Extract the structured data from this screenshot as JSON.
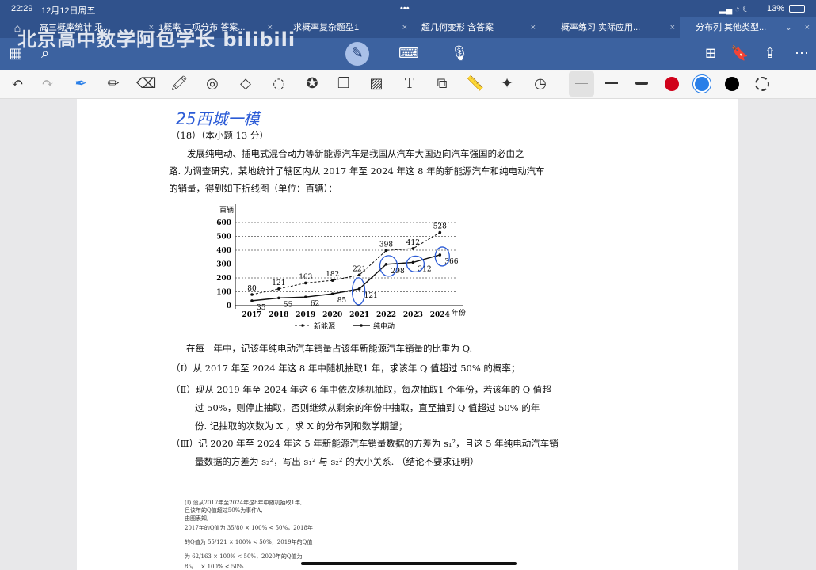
{
  "status": {
    "time": "22:29",
    "date": "12月12日周五",
    "battery": "13%"
  },
  "watermark": "北京高中数学阿包学长 bilibili",
  "tabs": [
    {
      "label": "高三概率统计 乘..."
    },
    {
      "label": "1概率 二项分布 答案..."
    },
    {
      "label": "求概率复杂题型1"
    },
    {
      "label": "超几何变形 含答案"
    },
    {
      "label": "概率练习 实际应用..."
    },
    {
      "label": "分布列 其他类型..."
    }
  ],
  "toolbar": {
    "left": [
      "grid-icon",
      "search-icon"
    ],
    "center": [
      "pen-mode-icon",
      "keyboard-icon",
      "microphone-icon"
    ],
    "right": [
      "add-page-icon",
      "bookmark-icon",
      "share-icon",
      "more-icon"
    ]
  },
  "tools": [
    "undo",
    "redo",
    "pen",
    "pencil",
    "eraser",
    "highlighter",
    "lasso-shape",
    "shapes",
    "lasso",
    "sticker",
    "sticky-note",
    "image",
    "text",
    "scan",
    "ruler",
    "laser",
    "timer"
  ],
  "colors": {
    "red": "#d0021b",
    "blue": "#2a7fe8",
    "black": "#000000",
    "ink": "#2b5bd6"
  },
  "doc": {
    "handwriting": "25西城一模",
    "header": "（18）（本小题 13 分）",
    "intro": [
      "发展纯电动、插电式混合动力等新能源汽车是我国从汽车大国迈向汽车强国的必由之",
      "路. 为调查研究，某地统计了辖区内从 2017 年至 2024 年这 8 年的新能源汽车和纯电动汽车",
      "的销量，得到如下折线图（单位：百辆）："
    ],
    "q_intro": "在每一年中，记该年纯电动汽车销量占该年新能源汽车销量的比重为 Q.",
    "q1": "（Ⅰ）从 2017 年至 2024 年这 8 年中随机抽取1 年，求该年 Q 值超过 50% 的概率；",
    "q2": [
      "（Ⅱ）现从 2019 年至 2024 年这 6 年中依次随机抽取，每次抽取1 个年份，若该年的 Q 值超",
      "过 50%，则停止抽取，否则继续从剩余的年份中抽取，直至抽到 Q 值超过 50% 的年",
      "份. 记抽取的次数为 X ，求 X 的分布列和数学期望；"
    ],
    "q3": [
      "（Ⅲ）记 2020 年至 2024 年这 5 年新能源汽车销量数据的方差为 s₁²，且这 5 年纯电动汽车销",
      "量数据的方差为 s₂²，写出 s₁² 与 s₂² 的大小关系. （结论不要求证明）"
    ],
    "answer": [
      "(I) 设从2017年至2024年这8年中随机抽取1年,",
      "且该年的Q值超过50%为事件A,",
      "由图表知,",
      "2017年的Q值为 35/80 × 100% < 50%，2018年",
      "的Q值为 55/121 × 100% < 50%，2019年的Q值",
      "为 62/163 × 100% < 50%，2020年的Q值为",
      "85/… × 100% < 50%"
    ]
  },
  "chart_data": {
    "type": "line",
    "ylabel": "百辆",
    "xlabel": "年份",
    "categories": [
      "2017",
      "2018",
      "2019",
      "2020",
      "2021",
      "2022",
      "2023",
      "2024"
    ],
    "yticks": [
      "0",
      "100",
      "200",
      "300",
      "400",
      "500",
      "600"
    ],
    "ylim": [
      0,
      600
    ],
    "series": [
      {
        "name": "新能源",
        "style": "dashed",
        "values": [
          80,
          121,
          163,
          182,
          221,
          398,
          412,
          528
        ]
      },
      {
        "name": "纯电动",
        "style": "solid",
        "values": [
          35,
          55,
          62,
          85,
          121,
          298,
          312,
          366
        ]
      }
    ]
  }
}
